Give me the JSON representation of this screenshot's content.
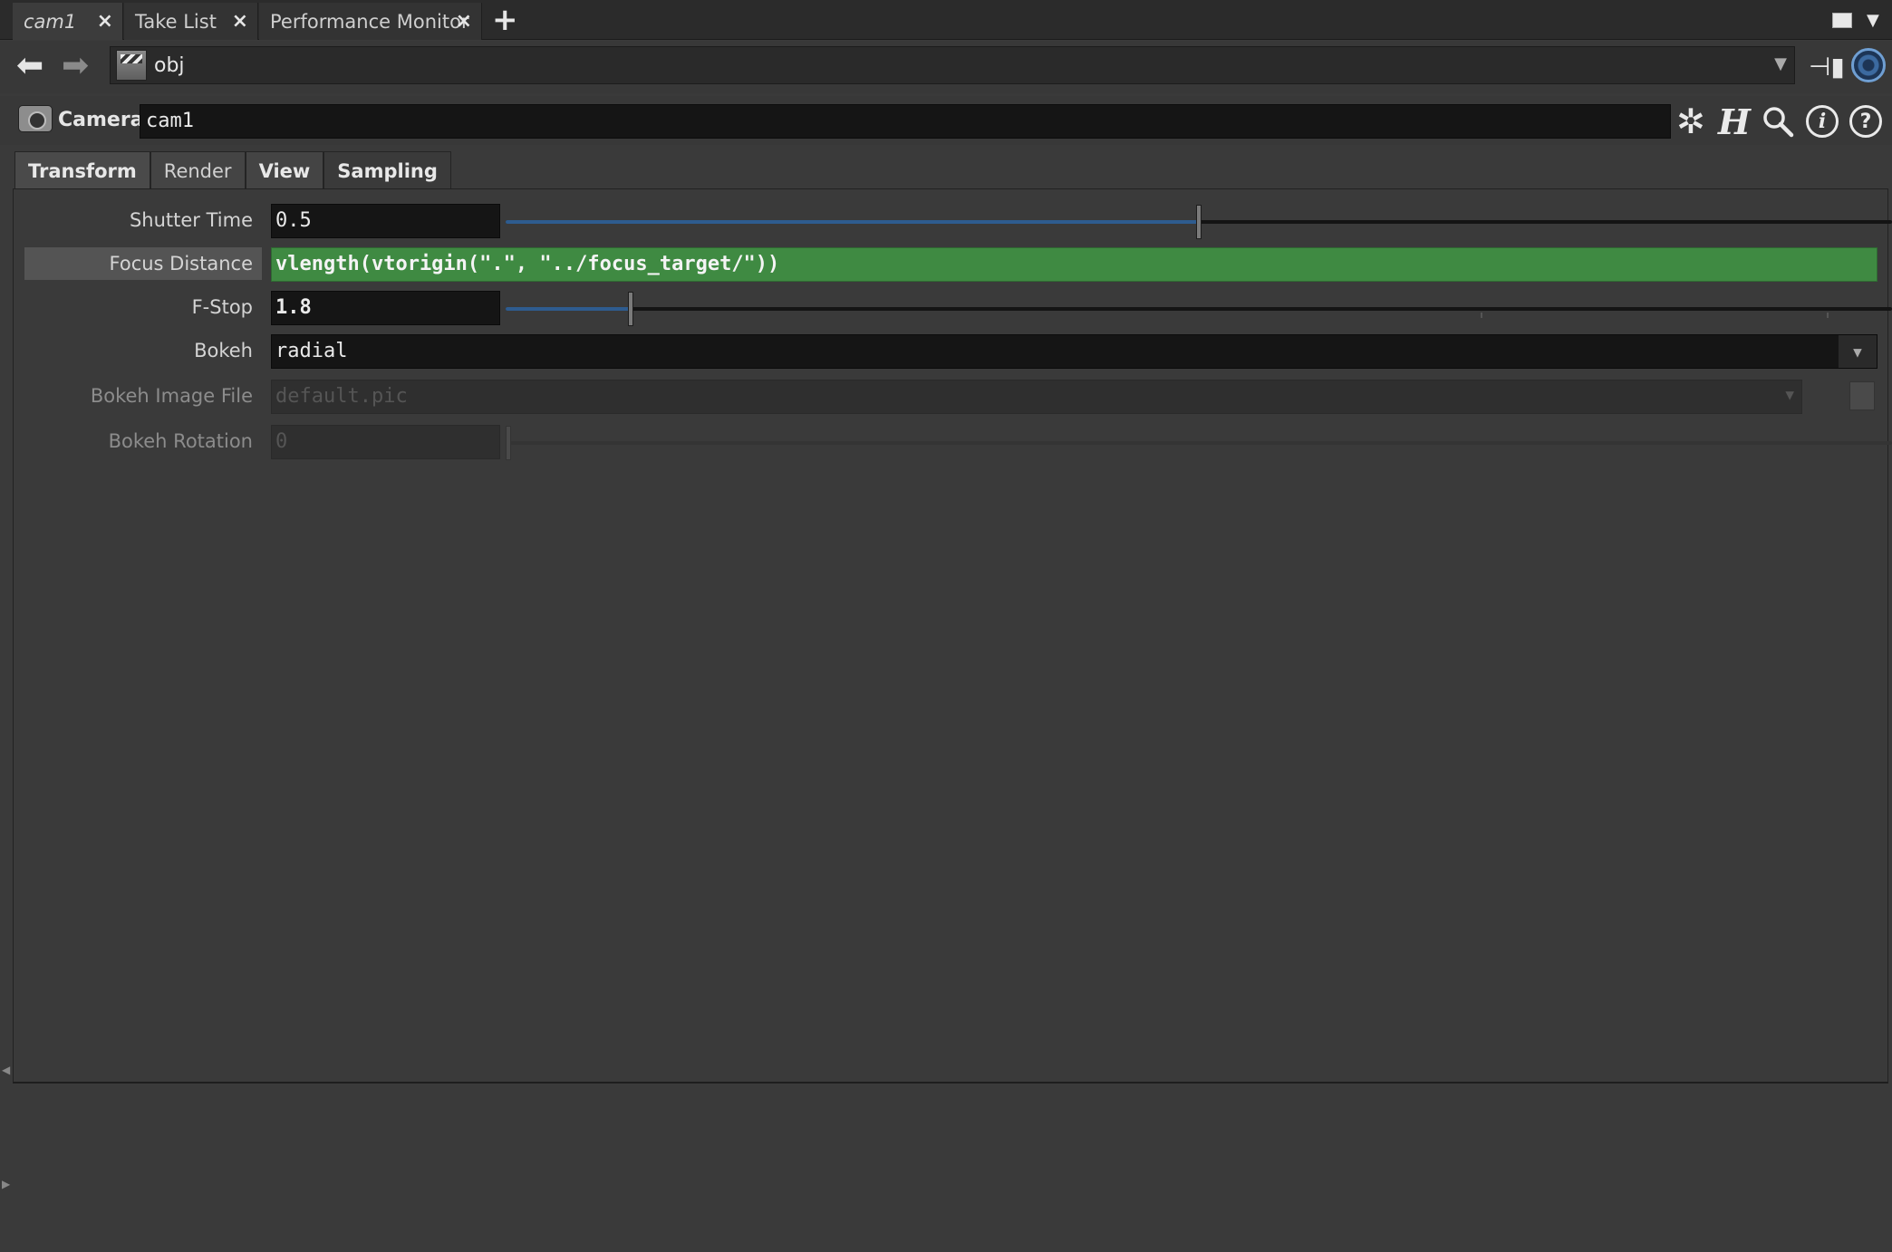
{
  "tabs": [
    {
      "label": "cam1",
      "active": true
    },
    {
      "label": "Take List",
      "active": false
    },
    {
      "label": "Performance Monitor",
      "active": false
    }
  ],
  "tab_close_glyph": "×",
  "tab_add_glyph": "+",
  "path": {
    "value": "obj"
  },
  "node": {
    "type_label": "Camera",
    "name": "cam1"
  },
  "param_tabs": [
    "Transform",
    "Render",
    "View",
    "Sampling"
  ],
  "params": {
    "shutter_time": {
      "label": "Shutter Time",
      "value": "0.5",
      "slider_fraction": 0.5
    },
    "focus_distance": {
      "label": "Focus Distance",
      "expression": "vlength(vtorigin(\".\", \"../focus_target/\"))"
    },
    "fstop": {
      "label": "F-Stop",
      "value": "1.8",
      "slider_fraction": 0.09
    },
    "bokeh": {
      "label": "Bokeh",
      "value": "radial"
    },
    "bokeh_image_file": {
      "label": "Bokeh Image File",
      "value": "default.pic"
    },
    "bokeh_rotation": {
      "label": "Bokeh Rotation",
      "value": "0",
      "slider_fraction": 0.0
    }
  },
  "colors": {
    "expression_bg": "#3f8a42",
    "slider_fill": "#2e5c8f",
    "link_icon": "#6f9fd3"
  }
}
